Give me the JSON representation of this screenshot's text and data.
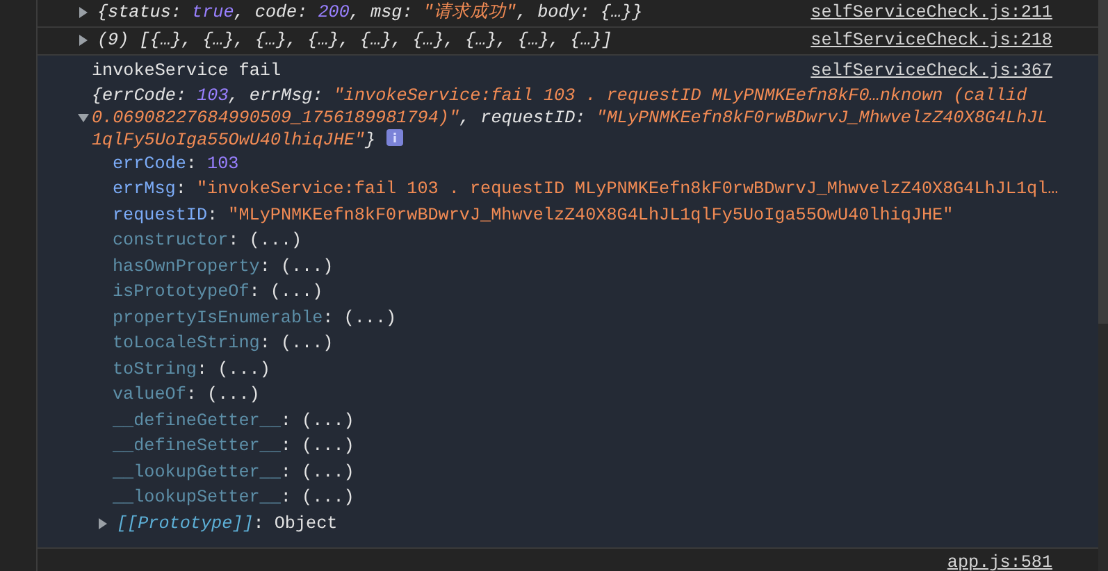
{
  "messages": [
    {
      "kind": "log",
      "selected": false,
      "expanded": false,
      "source": "selfServiceCheck.js:211",
      "preview": [
        {
          "text": "{status: ",
          "kind": "plain"
        },
        {
          "text": "true",
          "kind": "literal"
        },
        {
          "text": ", code: ",
          "kind": "plain"
        },
        {
          "text": "200",
          "kind": "literal"
        },
        {
          "text": ", msg: ",
          "kind": "plain"
        },
        {
          "text": "\"请求成功\"",
          "kind": "string"
        },
        {
          "text": ", body: {…}}",
          "kind": "plain"
        }
      ]
    },
    {
      "kind": "log",
      "selected": false,
      "expanded": false,
      "source": "selfServiceCheck.js:218",
      "preview": [
        {
          "text": "(9) [{…}, {…}, {…}, {…}, {…}, {…}, {…}, {…}, {…}]",
          "kind": "plain"
        }
      ]
    },
    {
      "kind": "object",
      "selected": true,
      "expanded": true,
      "text": "invokeService fail",
      "source": "selfServiceCheck.js:367",
      "preview": [
        {
          "text": "{errCode: ",
          "kind": "plain"
        },
        {
          "text": "103",
          "kind": "literal"
        },
        {
          "text": ", errMsg: ",
          "kind": "plain"
        },
        {
          "text": "\"invokeService:fail 103 . requestID MLyPNMKEefn8kF0…nknown (callid 0.06908227684990509_1756189981794)\"",
          "kind": "string"
        },
        {
          "text": ", requestID: ",
          "kind": "plain"
        },
        {
          "text": "\"MLyPNMKEefn8kF0rwBDwrvJ_MhwvelzZ40X8G4LhJL1qlFy5UoIga55OwU40lhiqJHE\"",
          "kind": "string"
        },
        {
          "text": "}",
          "kind": "plain"
        }
      ],
      "properties": [
        {
          "key": "errCode",
          "separator": ":",
          "value": "103",
          "kind": "literal",
          "own": true
        },
        {
          "key": "errMsg",
          "separator": ":",
          "value": "\"invokeService:fail 103 . requestID MLyPNMKEefn8kF0rwBDwrvJ_MhwvelzZ40X8G4LhJL1ql…",
          "kind": "string",
          "own": true
        },
        {
          "key": "requestID",
          "separator": ":",
          "value": "\"MLyPNMKEefn8kF0rwBDwrvJ_MhwvelzZ40X8G4LhJL1qlFy5UoIga55OwU40lhiqJHE\"",
          "kind": "string",
          "own": true
        },
        {
          "key": "constructor",
          "separator": ":",
          "value": "(...)",
          "kind": "plain",
          "own": false
        },
        {
          "key": "hasOwnProperty",
          "separator": ":",
          "value": "(...)",
          "kind": "plain",
          "own": false
        },
        {
          "key": "isPrototypeOf",
          "separator": ":",
          "value": "(...)",
          "kind": "plain",
          "own": false
        },
        {
          "key": "propertyIsEnumerable",
          "separator": ":",
          "value": "(...)",
          "kind": "plain",
          "own": false
        },
        {
          "key": "toLocaleString",
          "separator": ":",
          "value": "(...)",
          "kind": "plain",
          "own": false
        },
        {
          "key": "toString",
          "separator": ":",
          "value": "(...)",
          "kind": "plain",
          "own": false
        },
        {
          "key": "valueOf",
          "separator": ":",
          "value": "(...)",
          "kind": "plain",
          "own": false
        },
        {
          "key": "__defineGetter__",
          "separator": ":",
          "value": "(...)",
          "kind": "plain",
          "own": false
        },
        {
          "key": "__defineSetter__",
          "separator": ":",
          "value": "(...)",
          "kind": "plain",
          "own": false
        },
        {
          "key": "__lookupGetter__",
          "separator": ":",
          "value": "(...)",
          "kind": "plain",
          "own": false
        },
        {
          "key": "__lookupSetter__",
          "separator": ":",
          "value": "(...)",
          "kind": "plain",
          "own": false
        }
      ],
      "prototype": {
        "key": "[[Prototype]]",
        "separator": ":",
        "value": "Object",
        "expanded": false
      }
    },
    {
      "kind": "source_only",
      "selected": false,
      "source": "app.js:581"
    }
  ]
}
